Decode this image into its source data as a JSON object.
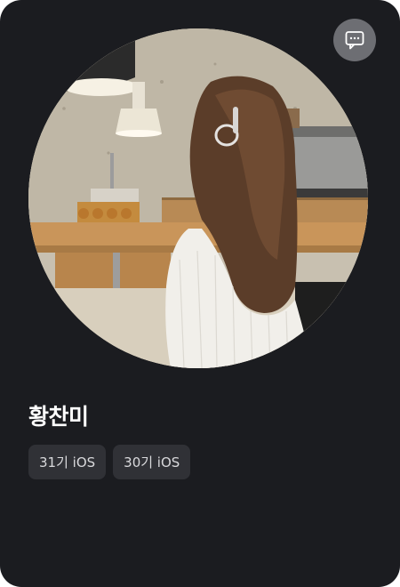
{
  "profile": {
    "name": "황찬미",
    "tags": [
      "31기 iOS",
      "30기 iOS"
    ]
  },
  "icons": {
    "chat": "chat-bubble-icon"
  },
  "colors": {
    "card_background": "#1b1c20",
    "tag_background": "#303136",
    "chat_button_background": "#6d6e73",
    "name_text": "#ffffff",
    "tag_text": "#d9d9dc"
  }
}
